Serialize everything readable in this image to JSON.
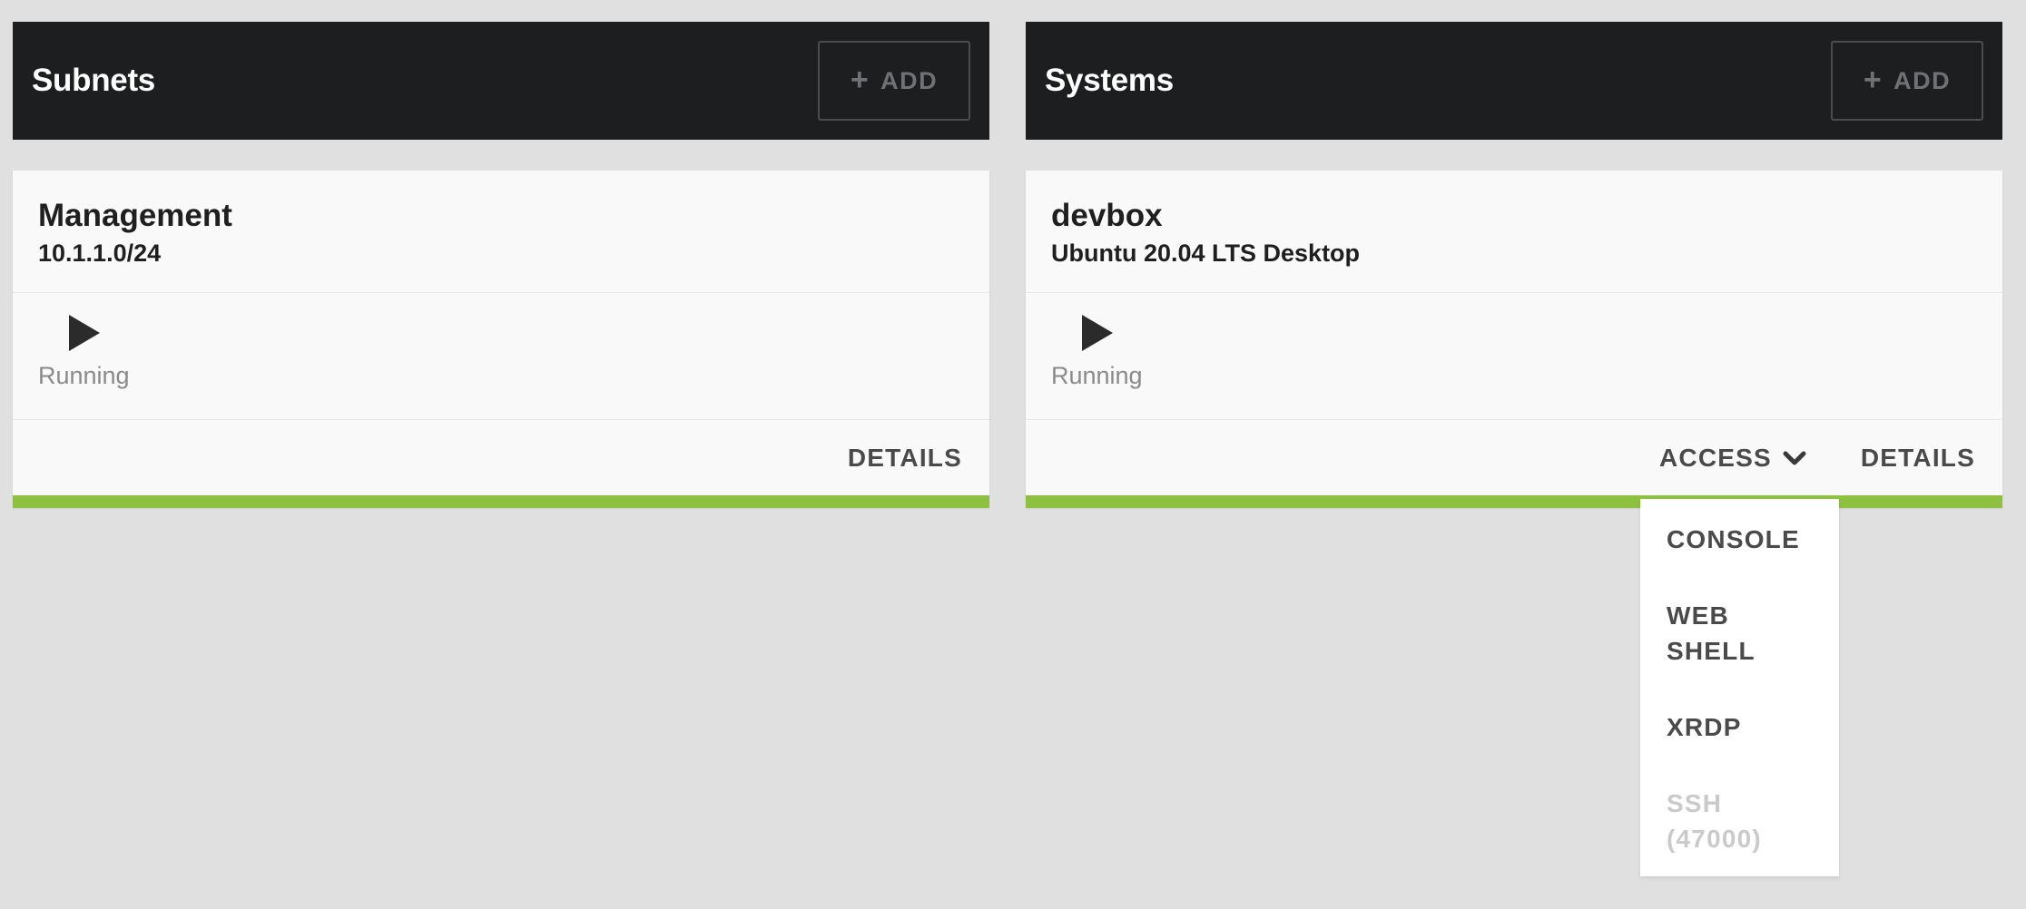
{
  "subnets": {
    "title": "Subnets",
    "add_label": "ADD",
    "card": {
      "name": "Management",
      "subtitle": "10.1.1.0/24",
      "status": "Running",
      "details_label": "DETAILS"
    }
  },
  "systems": {
    "title": "Systems",
    "add_label": "ADD",
    "card": {
      "name": "devbox",
      "subtitle": "Ubuntu 20.04 LTS Desktop",
      "status": "Running",
      "access_label": "ACCESS",
      "details_label": "DETAILS"
    },
    "access_menu": {
      "items": [
        {
          "label": "CONSOLE",
          "enabled": true
        },
        {
          "label": "WEB SHELL",
          "enabled": true
        },
        {
          "label": "XRDP",
          "enabled": true
        },
        {
          "label": "SSH (47000)",
          "enabled": false
        }
      ]
    }
  },
  "colors": {
    "header_bg": "#1d1e20",
    "status_running": "#8dc13f",
    "page_bg": "#dfe0df"
  }
}
